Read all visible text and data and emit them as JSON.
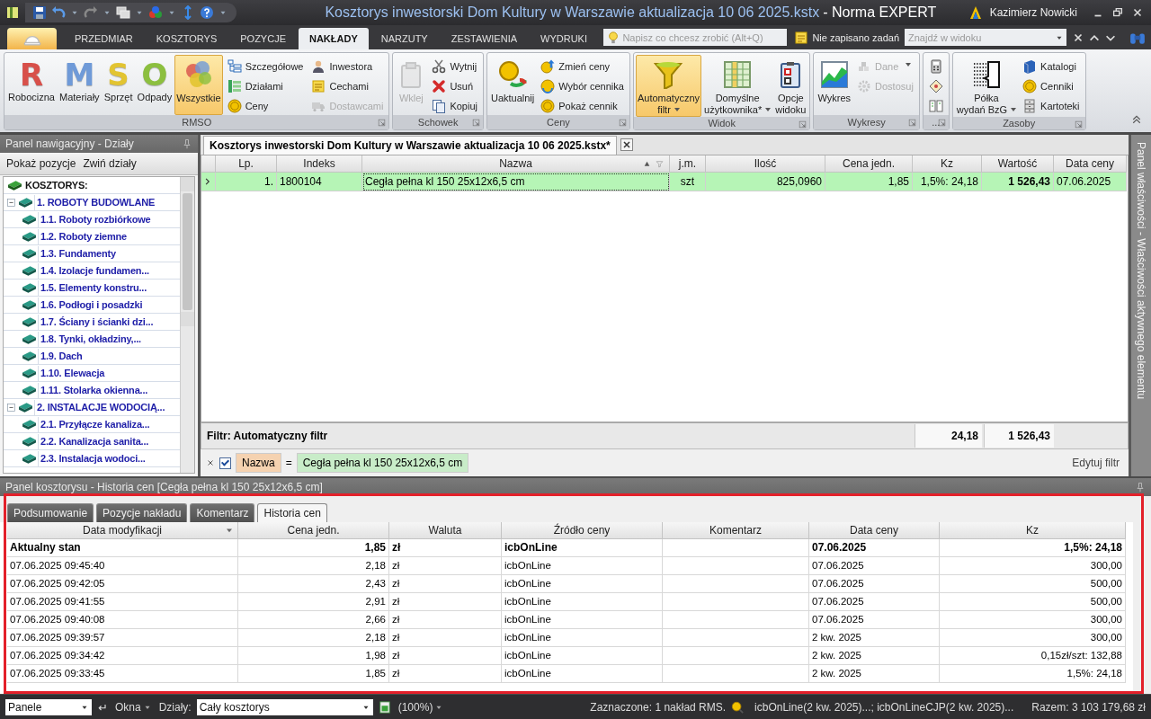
{
  "window": {
    "document_title": "Kosztorys inwestorski Dom Kultury w Warszawie aktualizacja 10 06 2025.kstx",
    "app_title": "- Norma EXPERT",
    "user": "Kazimierz Nowicki"
  },
  "ribbon_tabs": [
    {
      "label": "PRZEDMIAR",
      "selected": false
    },
    {
      "label": "KOSZTORYS",
      "selected": false
    },
    {
      "label": "POZYCJE",
      "selected": false
    },
    {
      "label": "NAKŁADY",
      "selected": true
    },
    {
      "label": "NARZUTY",
      "selected": false
    },
    {
      "label": "ZESTAWIENIA",
      "selected": false
    },
    {
      "label": "WYDRUKI",
      "selected": false
    }
  ],
  "tell_me": {
    "placeholder": "Napisz co chcesz zrobić (Alt+Q)"
  },
  "tasks": "Nie zapisano zadań",
  "find": {
    "placeholder": "Znajdź w widoku"
  },
  "ribbon_groups": [
    {
      "label": "RMSO",
      "items": [
        {
          "kind": "letter",
          "glyph": "R",
          "color": "#d8504a",
          "label": "Robocizna",
          "selected": false,
          "disabled": false
        },
        {
          "kind": "letter",
          "glyph": "M",
          "color": "#6f9ad8",
          "label": "Materiały",
          "selected": false,
          "disabled": false
        },
        {
          "kind": "letter",
          "glyph": "S",
          "color": "#e2c431",
          "label": "Sprzęt",
          "selected": false,
          "disabled": false
        },
        {
          "kind": "letter",
          "glyph": "O",
          "color": "#8cbf3f",
          "label": "Odpady",
          "selected": false,
          "disabled": false
        },
        {
          "kind": "large",
          "label": "Wszystkie",
          "selected": true,
          "disabled": false
        },
        {
          "kind": "small",
          "label": "Szczegółowe",
          "selected": false,
          "disabled": false
        },
        {
          "kind": "small",
          "label": "Działami",
          "selected": false,
          "disabled": false
        },
        {
          "kind": "small",
          "label": "Ceny",
          "selected": false,
          "disabled": false
        },
        {
          "kind": "small",
          "label": "Inwestora",
          "selected": false,
          "disabled": false
        },
        {
          "kind": "small",
          "label": "Cechami",
          "selected": false,
          "disabled": false
        },
        {
          "kind": "small",
          "label": "Dostawcami",
          "selected": false,
          "disabled": true
        }
      ]
    },
    {
      "label": "Schowek",
      "items": [
        {
          "kind": "large",
          "label": "Wklej",
          "selected": false,
          "disabled": true
        },
        {
          "kind": "small",
          "label": "Wytnij",
          "selected": false,
          "disabled": false
        },
        {
          "kind": "small",
          "label": "Usuń",
          "selected": false,
          "disabled": false
        },
        {
          "kind": "small",
          "label": "Kopiuj",
          "selected": false,
          "disabled": false
        }
      ]
    },
    {
      "label": "Ceny",
      "items": [
        {
          "kind": "large",
          "label": "Uaktualnij",
          "selected": false,
          "disabled": false
        },
        {
          "kind": "small",
          "label": "Zmień ceny",
          "selected": false,
          "disabled": false
        },
        {
          "kind": "small",
          "label": "Wybór cennika",
          "selected": false,
          "disabled": false
        },
        {
          "kind": "small",
          "label": "Pokaż cennik",
          "selected": false,
          "disabled": false
        }
      ]
    },
    {
      "label": "Widok",
      "items": [
        {
          "kind": "large",
          "label": "Automatyczny\nfiltr",
          "dropdown": true,
          "selected": true,
          "disabled": false
        },
        {
          "kind": "large",
          "label": "Domyślne\nużytkownika*",
          "dropdown": true,
          "selected": false,
          "disabled": false
        },
        {
          "kind": "large",
          "label": "Opcje\nwidoku",
          "selected": false,
          "disabled": false
        }
      ]
    },
    {
      "label": "Wykresy",
      "items": [
        {
          "kind": "large",
          "label": "Wykres",
          "selected": false,
          "disabled": false
        },
        {
          "kind": "small",
          "label": "Dane",
          "dropdown": true,
          "selected": false,
          "disabled": true
        },
        {
          "kind": "small",
          "label": "Dostosuj",
          "selected": false,
          "disabled": true
        }
      ]
    },
    {
      "label": "...",
      "items": [
        {
          "kind": "icon",
          "selected": false,
          "disabled": false
        },
        {
          "kind": "icon",
          "selected": false,
          "disabled": false
        },
        {
          "kind": "icon",
          "selected": false,
          "disabled": false
        }
      ]
    },
    {
      "label": "Zasoby",
      "items": [
        {
          "kind": "large",
          "label": "Półka\nwydań BzG",
          "dropdown": true,
          "selected": false,
          "disabled": false
        },
        {
          "kind": "small",
          "label": "Katalogi",
          "selected": false,
          "disabled": false
        },
        {
          "kind": "small",
          "label": "Cenniki",
          "selected": false,
          "disabled": false
        },
        {
          "kind": "small",
          "label": "Kartoteki",
          "selected": false,
          "disabled": false
        }
      ]
    }
  ],
  "nav": {
    "title": "Panel nawigacyjny - Działy",
    "actions": [
      "Pokaż pozycje",
      "Zwiń działy"
    ],
    "tree": [
      {
        "label": "KOSZTORYS:",
        "kind": "root",
        "children": [
          {
            "label": "1. ROBOTY BUDOWLANE",
            "expanded": true,
            "children": [
              {
                "label": "1.1. Roboty rozbiórkowe"
              },
              {
                "label": "1.2. Roboty ziemne"
              },
              {
                "label": "1.3. Fundamenty"
              },
              {
                "label": "1.4. Izolacje fundamen..."
              },
              {
                "label": "1.5. Elementy konstru..."
              },
              {
                "label": "1.6. Podłogi i posadzki"
              },
              {
                "label": "1.7. Ściany i ścianki dzi..."
              },
              {
                "label": "1.8. Tynki, okładziny,..."
              },
              {
                "label": "1.9. Dach"
              },
              {
                "label": "1.10. Elewacja"
              },
              {
                "label": "1.11. Stolarka okienna..."
              }
            ]
          },
          {
            "label": "2. INSTALACJE WODOCIĄ...",
            "expanded": true,
            "children": [
              {
                "label": "2.1. Przyłącze kanaliza..."
              },
              {
                "label": "2.2. Kanalizacja sanita..."
              },
              {
                "label": "2.3. Instalacja wodoci..."
              }
            ]
          }
        ]
      }
    ]
  },
  "document": {
    "tab": "Kosztorys inwestorski Dom Kultury w Warszawie aktualizacja 10 06 2025.kstx*",
    "columns": [
      {
        "label": "Lp."
      },
      {
        "label": "Indeks"
      },
      {
        "label": "Nazwa",
        "sorted": true,
        "filtered": true
      },
      {
        "label": "j.m."
      },
      {
        "label": "Ilość"
      },
      {
        "label": "Cena jedn."
      },
      {
        "label": "Kz"
      },
      {
        "label": "Wartość"
      },
      {
        "label": "Data ceny"
      }
    ],
    "rows": [
      {
        "selected": true,
        "cells": [
          "1.",
          "1800104",
          "Cegła pełna kl 150 25x12x6,5 cm",
          "szt",
          "825,0960",
          "1,85",
          "1,5%: 24,18",
          "1 526,43",
          "07.06.2025"
        ]
      }
    ],
    "footer": {
      "label": "Filtr: Automatyczny filtr",
      "kz_total": "24,18",
      "value_total": "1 526,43"
    },
    "filter_bar": {
      "enabled": true,
      "field": "Nazwa",
      "operator": "=",
      "value": "Cegła pełna kl 150 25x12x6,5 cm",
      "edit": "Edytuj filtr"
    }
  },
  "right_panel": {
    "title": "Panel właściwości - Właściwości aktywnego elementu"
  },
  "bottom_panel": {
    "title": "Panel kosztorysu - Historia cen [Cegła pełna kl 150 25x12x6,5 cm]",
    "tabs": [
      {
        "label": "Podsumowanie",
        "selected": false
      },
      {
        "label": "Pozycje nakładu",
        "selected": false
      },
      {
        "label": "Komentarz",
        "selected": false
      },
      {
        "label": "Historia cen",
        "selected": true
      }
    ],
    "columns": [
      "Data modyfikacji",
      "Cena jedn.",
      "Waluta",
      "Źródło ceny",
      "Komentarz",
      "Data ceny",
      "Kz"
    ],
    "rows": [
      {
        "kind": "current",
        "modified": "Aktualny stan",
        "price": "1,85",
        "currency": "zł",
        "source": "icbOnLine",
        "price_date": "07.06.2025",
        "kz": "1,5%: 24,18"
      },
      {
        "kind": "entry",
        "modified": "07.06.2025 09:45:40",
        "price": "2,18",
        "currency": "zł",
        "source": "icbOnLine",
        "price_date": "07.06.2025",
        "kz": "300,00"
      },
      {
        "kind": "entry",
        "modified": "07.06.2025 09:42:05",
        "price": "2,43",
        "currency": "zł",
        "source": "icbOnLine",
        "price_date": "07.06.2025",
        "kz": "500,00"
      },
      {
        "kind": "entry",
        "modified": "07.06.2025 09:41:55",
        "price": "2,91",
        "currency": "zł",
        "source": "icbOnLine",
        "price_date": "07.06.2025",
        "kz": "500,00"
      },
      {
        "kind": "entry",
        "modified": "07.06.2025 09:40:08",
        "price": "2,66",
        "currency": "zł",
        "source": "icbOnLine",
        "price_date": "07.06.2025",
        "kz": "300,00"
      },
      {
        "kind": "entry",
        "modified": "07.06.2025 09:39:57",
        "price": "2,18",
        "currency": "zł",
        "source": "icbOnLine",
        "price_date": "2 kw. 2025",
        "kz": "300,00"
      },
      {
        "kind": "entry",
        "modified": "07.06.2025 09:34:42",
        "price": "1,98",
        "currency": "zł",
        "source": "icbOnLine",
        "price_date": "2 kw. 2025",
        "kz": "0,15zł/szt: 132,88"
      },
      {
        "kind": "entry",
        "modified": "07.06.2025 09:33:45",
        "price": "1,85",
        "currency": "zł",
        "source": "icbOnLine",
        "price_date": "2 kw. 2025",
        "kz": "1,5%: 24,18"
      }
    ]
  },
  "status_bar": {
    "panels": "Panele",
    "windows": "Okna",
    "sections_label": "Działy:",
    "sections": "Cały kosztorys",
    "zoom": "(100%)",
    "selection": "Zaznaczone: 1 nakład RMS.",
    "sources": "icbOnLine(2 kw. 2025)...; icbOnLineCJP(2 kw. 2025)...",
    "total": "Razem: 3 103 179,68 zł"
  }
}
